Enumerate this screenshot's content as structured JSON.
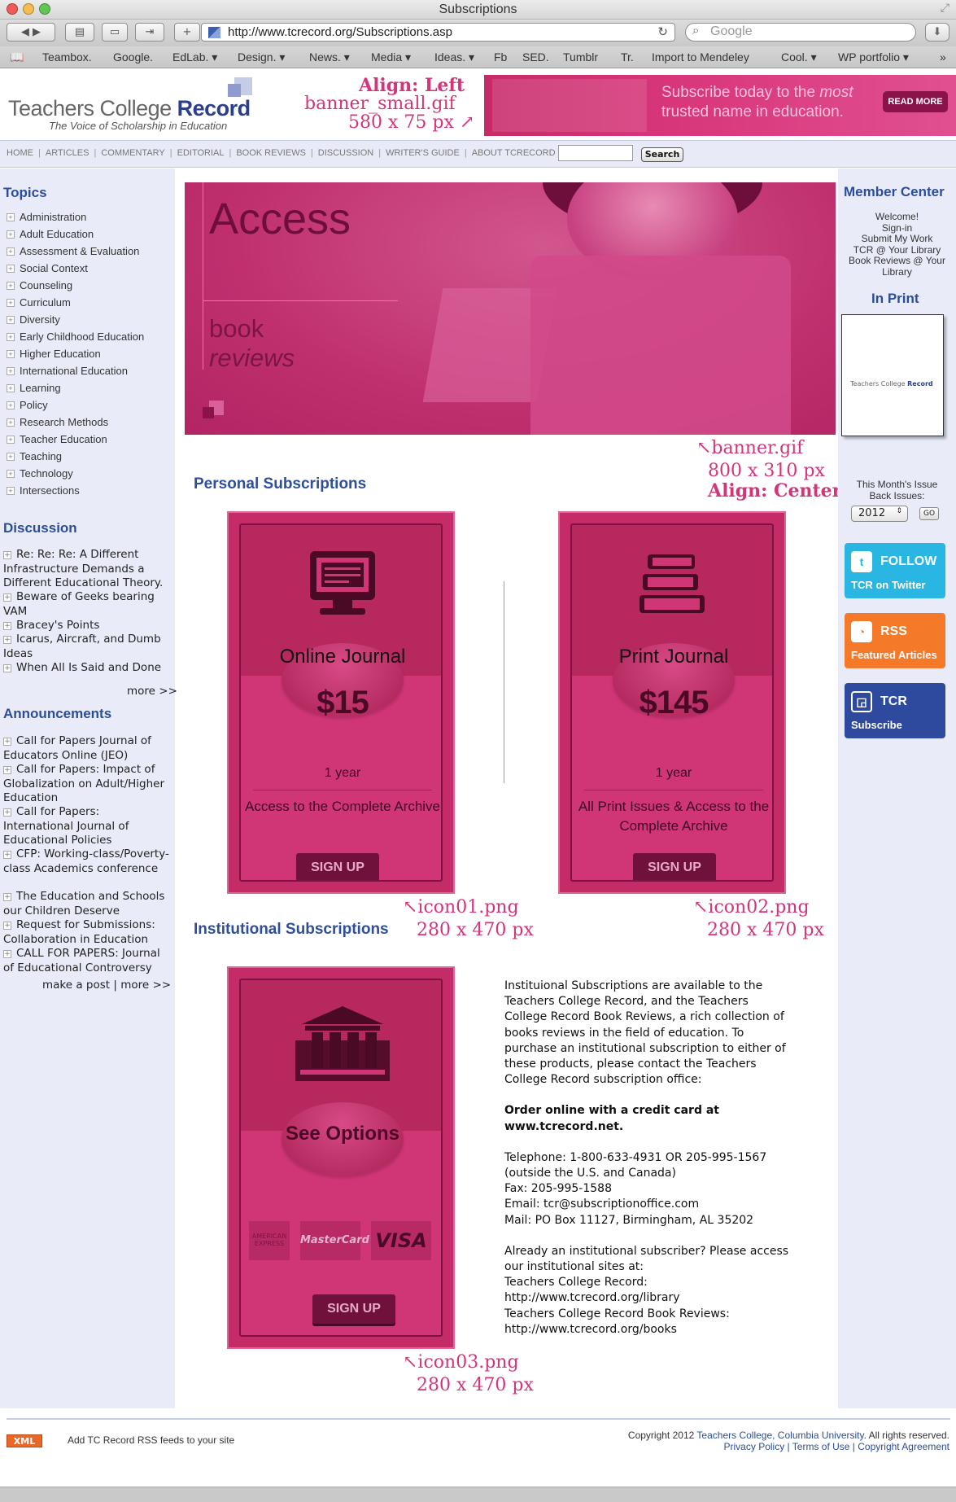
{
  "window": {
    "title": "Subscriptions"
  },
  "browser": {
    "url": "http://www.tcrecord.org/Subscriptions.asp",
    "search_placeholder": "Google",
    "bookmarks": [
      "Teambox.",
      "Google.",
      "EdLab. ▾",
      "Design. ▾",
      "News. ▾",
      "Media ▾",
      "Ideas. ▾",
      "Fb",
      "SED.",
      "Tumblr",
      "Tr.",
      "Import to Mendeley",
      "Cool. ▾",
      "WP portfolio ▾"
    ]
  },
  "header": {
    "logo_light": "Teachers College ",
    "logo_bold": "Record",
    "tagline": "The Voice of Scholarship in Education",
    "annotation_small": [
      "Align: Left",
      "banner_small.gif",
      "580 x 75 px ↗"
    ],
    "banner_line1_a": "Subscribe today to the ",
    "banner_line1_em": "most",
    "banner_line2": "trusted name in education.",
    "read_more": "READ MORE"
  },
  "nav": {
    "links": [
      "HOME",
      "ARTICLES",
      "COMMENTARY",
      "EDITORIAL",
      "BOOK REVIEWS",
      "DISCUSSION",
      "WRITER'S GUIDE",
      "ABOUT TCRECORD"
    ],
    "search_button": "Search"
  },
  "left": {
    "topics_heading": "Topics",
    "topics": [
      "Administration",
      "Adult Education",
      "Assessment & Evaluation",
      "Social Context",
      "Counseling",
      "Curriculum",
      "Diversity",
      "Early Childhood Education",
      "Higher Education",
      "International Education",
      "Learning",
      "Policy",
      "Research Methods",
      "Teacher Education",
      "Teaching",
      "Technology",
      "Intersections"
    ],
    "discussion_heading": "Discussion",
    "discussion": [
      "Re: Re: Re: A Different Infrastructure Demands a Different Educational Theory.",
      "Beware of Geeks bearing VAM",
      "Bracey's Points",
      "Icarus, Aircraft, and Dumb Ideas",
      "When All Is Said and Done"
    ],
    "discussion_more": "more >>",
    "announcements_heading": "Announcements",
    "announcements": [
      "Call for Papers Journal of Educators Online (JEO)",
      "Call for Papers: Impact of Globalization on Adult/Higher Education",
      "Call for Papers: International Journal of Educational Policies",
      "CFP: Working-class/Poverty-class Academics conference",
      "The Education and Schools our Children Deserve",
      "Request for Submissions: Collaboration in Education",
      "CALL FOR PAPERS: Journal of Educational Controversy"
    ],
    "make_post": "make a post",
    "ann_more": "more >>"
  },
  "hero": {
    "title": "Access",
    "sub1": "book",
    "sub2": "reviews",
    "annotation": [
      "↖banner.gif",
      "800 x 310 px",
      "Align: Center"
    ]
  },
  "personal": {
    "heading": "Personal Subscriptions",
    "cards": [
      {
        "name": "Online Journal",
        "price": "$15",
        "term": "1 year",
        "desc": "Access to the Complete Archive",
        "button": "SIGN UP",
        "icon": "monitor-icon",
        "annotation": [
          "↖icon01.png",
          "280 x 470 px"
        ]
      },
      {
        "name": "Print Journal",
        "price": "$145",
        "term": "1 year",
        "desc": "All Print Issues & Access to the Complete Archive",
        "button": "SIGN UP",
        "icon": "books-icon",
        "annotation": [
          "↖icon02.png",
          "280 x 470 px"
        ]
      }
    ]
  },
  "institutional": {
    "heading": "Institutional Subscriptions",
    "card": {
      "name": "See Options",
      "button": "SIGN UP",
      "icon": "building-icon",
      "payment": [
        "AMERICAN EXPRESS",
        "MasterCard",
        "VISA"
      ],
      "annotation": [
        "↖icon03.png",
        "280 x 470 px"
      ]
    },
    "intro": "Instituional Subscriptions are available to the Teachers College Record, and the Teachers College Record Book Reviews, a rich collection of books reviews in the field of education. To purchase an institutional subscription to either of these products, please contact the Teachers College Record subscription office:",
    "order": "Order online with a credit card at www.tcrecord.net.",
    "contact": [
      "Telephone: 1-800-633-4931 OR 205-995-1567",
      "(outside the U.S. and Canada)",
      "Fax: 205-995-1588",
      "Email: tcr@subscriptionoffice.com",
      "Mail: PO Box 11127, Birmingham, AL 35202"
    ],
    "already": [
      "Already an institutional subscriber? Please access our institutional sites at:",
      "Teachers College Record:",
      "http://www.tcrecord.org/library",
      "Teachers College Record Book Reviews:",
      "http://www.tcrecord.org/books"
    ]
  },
  "right": {
    "member_heading": "Member Center",
    "member_links": [
      "Welcome!",
      "Sign-in",
      "Submit My Work",
      "TCR @ Your Library",
      "Book Reviews @ Your Library"
    ],
    "in_print_heading": "In Print",
    "issue_label": "This Month's Issue",
    "back_issues": "Back Issues:",
    "year": "2012",
    "go": "GO",
    "twitter": {
      "t1": "FOLLOW",
      "t2": "TCR on Twitter",
      "color": "#29b6e3"
    },
    "rss": {
      "t1": "RSS",
      "t2": "Featured Articles",
      "color": "#f47a2a"
    },
    "tcr": {
      "t1": "TCR",
      "t2": "Subscribe",
      "color": "#2e4a9e"
    }
  },
  "footer": {
    "xml": "XML",
    "rss_text": "Add TC Record RSS feeds to your site",
    "copy_a": "Copyright 2012 ",
    "copy_link": "Teachers College, Columbia University",
    "copy_b": ". All rights reserved.",
    "links": [
      "Privacy Policy",
      "Terms of Use",
      "Copyright Agreement"
    ]
  },
  "colors": {
    "accent": "#c52b67",
    "link": "#2b4e9b",
    "annotation": "#d4357a"
  }
}
